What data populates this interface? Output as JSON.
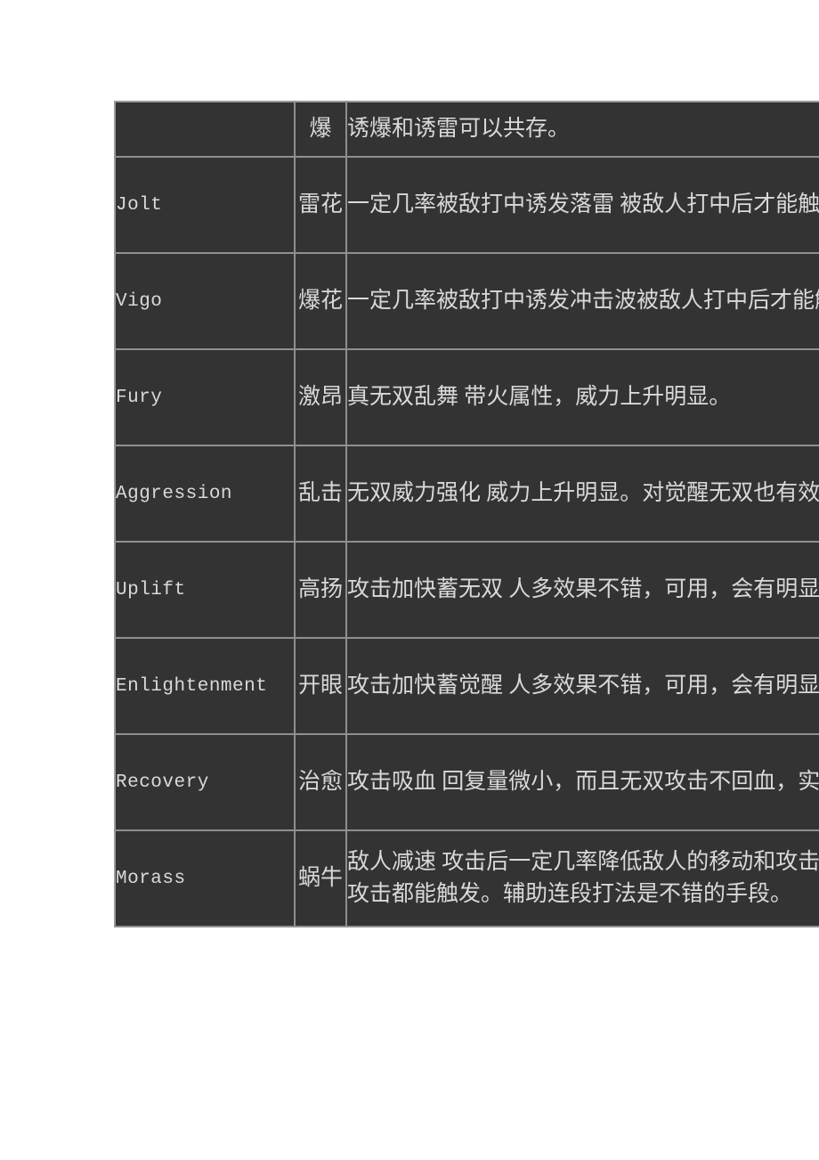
{
  "table": {
    "columns": [
      "name",
      "abbr",
      "description"
    ],
    "rows": [
      {
        "name": "",
        "abbr": "爆",
        "description": [
          "诱爆和诱雷可以共存。"
        ]
      },
      {
        "name": "Jolt",
        "abbr": "雷花",
        "description": [
          "一定几率被敌打中诱发落雷 被敌人打中后才能触发，被动技能。"
        ]
      },
      {
        "name": "Vigo",
        "abbr": "爆花",
        "description": [
          "一定几率被敌打中诱发冲击波被敌人打中后才能触发，被动技能。"
        ]
      },
      {
        "name": "Fury",
        "abbr": "激昂",
        "description": [
          "真无双乱舞 带火属性，威力上升明显。"
        ]
      },
      {
        "name": "Aggression",
        "abbr": "乱击",
        "description": [
          "无双威力强化 威力上升明显。对觉醒无双也有效果。"
        ]
      },
      {
        "name": "Uplift",
        "abbr": "高扬",
        "description": [
          "攻击加快蓄无双 人多效果不错，可用，会有明显提升。"
        ]
      },
      {
        "name": "Enlightenment",
        "abbr": "开眼",
        "description": [
          "攻击加快蓄觉醒 人多效果不错，可用，会有明显提升。"
        ]
      },
      {
        "name": "Recovery",
        "abbr": "治愈",
        "description": [
          "攻击吸血 回复量微小，而且无双攻击不回血，实用性低。"
        ]
      },
      {
        "name": "Morass",
        "abbr": "蜗牛",
        "description": [
          "敌人减速 攻击后一定几率降低敌人的移动和攻击速度，普通",
          "攻击都能触发。辅助连段打法是不错的手段。"
        ]
      }
    ]
  },
  "colors": {
    "page_background": "#ffffff",
    "table_background": "#333333",
    "border": "#8f8f8f",
    "text": "#d6d6d6"
  }
}
